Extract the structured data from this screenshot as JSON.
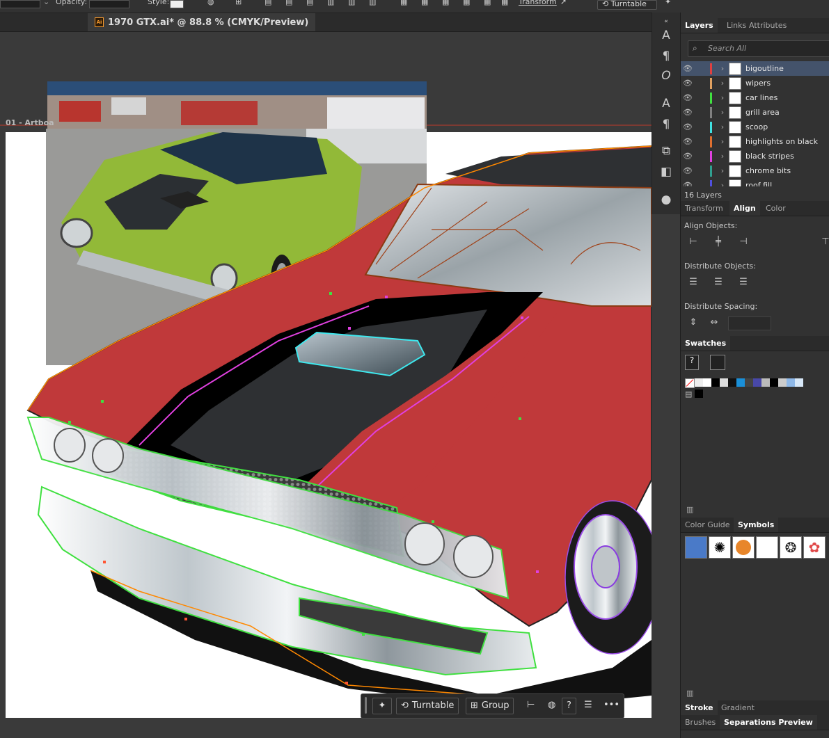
{
  "toolbar": {
    "opacity_label": "Opacity:",
    "style_label": "Style:",
    "transform_label": "Transform",
    "turntable_label": "Turntable"
  },
  "document": {
    "tab_title": "1970 GTX.ai* @ 88.8 % (CMYK/Preview)",
    "app_badge": "Ai",
    "artboard_label": "01 - Artboa"
  },
  "layers_panel": {
    "tabs": [
      "Layers",
      "Links",
      "Attributes"
    ],
    "search_placeholder": "Search All",
    "layers": [
      {
        "name": "bigoutline",
        "color": "#e04040",
        "selected": true
      },
      {
        "name": "wipers",
        "color": "#e0a060"
      },
      {
        "name": "car lines",
        "color": "#40e040"
      },
      {
        "name": "grill area",
        "color": "#808080"
      },
      {
        "name": "scoop",
        "color": "#40e0e0"
      },
      {
        "name": "highlights on black",
        "color": "#e07030"
      },
      {
        "name": "black stripes",
        "color": "#e040e0"
      },
      {
        "name": "chrome bits",
        "color": "#30a090"
      },
      {
        "name": "roof fill",
        "color": "#5050e0"
      }
    ],
    "count": "16 Layers"
  },
  "align_panel": {
    "tabs": [
      "Transform",
      "Align",
      "Color"
    ],
    "align_objects": "Align Objects:",
    "distribute_objects": "Distribute Objects:",
    "distribute_spacing": "Distribute Spacing:"
  },
  "swatches_panel": {
    "tab": "Swatches"
  },
  "symbols_panel": {
    "tabs": [
      "Color Guide",
      "Symbols"
    ]
  },
  "stroke_panel": {
    "tabs": [
      "Stroke",
      "Gradient"
    ]
  },
  "brushes_panel": {
    "tabs": [
      "Brushes",
      "Separations Preview"
    ]
  },
  "context_bar": {
    "turntable": "Turntable",
    "group": "Group",
    "help": "?",
    "more": "•••"
  },
  "colors": {
    "car_red": "#c0393a",
    "stripe_black": "#2e3033",
    "selection_blue": "#44536b"
  }
}
